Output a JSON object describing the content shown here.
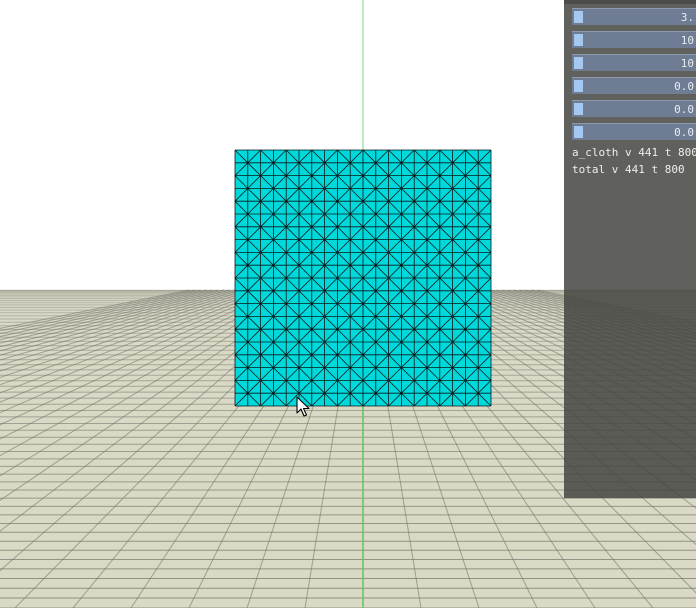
{
  "colors": {
    "sky": "#ffffff",
    "ground": "#d9d9c6",
    "grid_line": "#6e6e66",
    "axis_green": "#59c95a",
    "cloth": "#00d9dc",
    "cloth_edge": "#0a1a1a"
  },
  "panel": {
    "sliders": [
      {
        "value": "3."
      },
      {
        "value": "10"
      },
      {
        "value": "10"
      },
      {
        "value": "0.0"
      },
      {
        "value": "0.0"
      },
      {
        "value": "0.0"
      }
    ],
    "stats": [
      {
        "text": "a_cloth v 441 t 800"
      },
      {
        "text": "total v 441 t 800"
      }
    ]
  },
  "cursor": {
    "icon": "arrow-cursor-icon"
  }
}
